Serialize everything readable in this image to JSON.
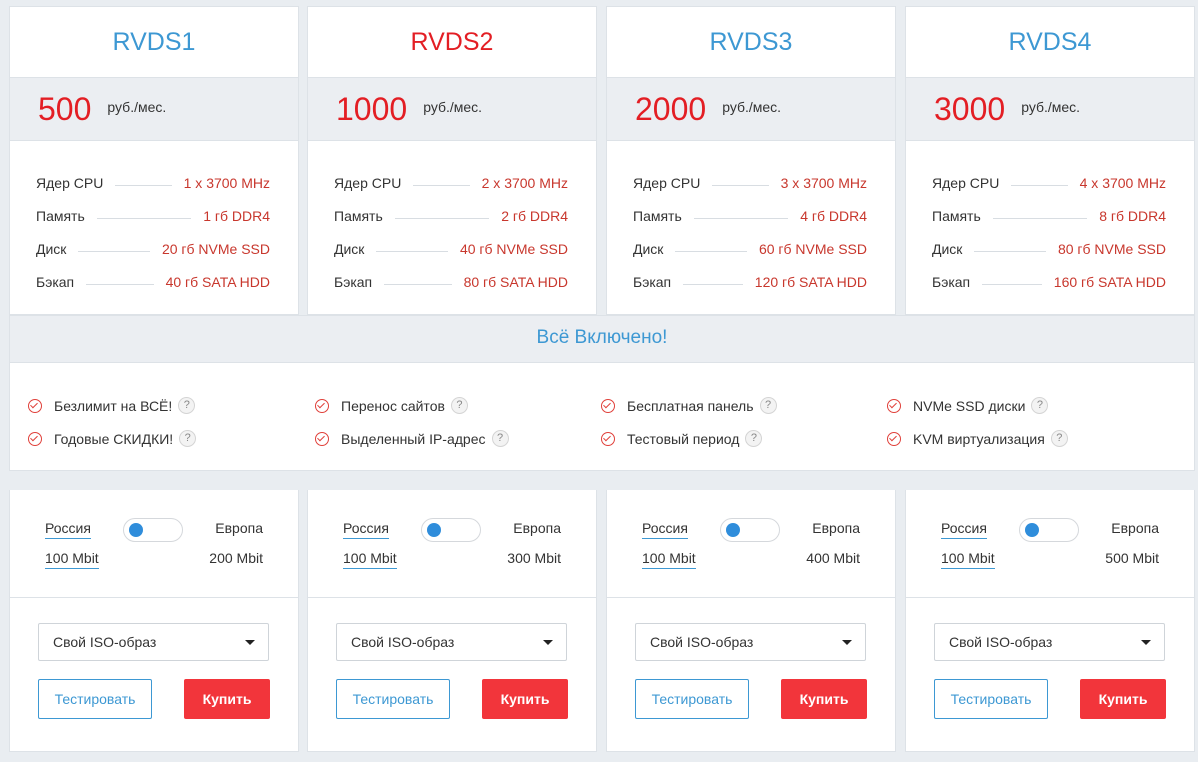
{
  "colors": {
    "accent_blue": "#3d98d3",
    "accent_red": "#e31e24",
    "buy_button": "#f2353b",
    "background": "#e9edf1"
  },
  "plans": [
    {
      "name": "RVDS1",
      "highlight": false,
      "price": "500",
      "unit": "руб./мес.",
      "specs": [
        {
          "label": "Ядер CPU",
          "value": "1 x 3700 MHz"
        },
        {
          "label": "Память",
          "value": "1 гб DDR4"
        },
        {
          "label": "Диск",
          "value": "20 гб NVMe SSD"
        },
        {
          "label": "Бэкап",
          "value": "40 гб SATA HDD"
        }
      ],
      "region_left": "Россия",
      "region_right": "Европа",
      "speed_left": "100 Mbit",
      "speed_right": "200 Mbit",
      "iso_select": "Свой ISO-образ",
      "test_label": "Тестировать",
      "buy_label": "Купить"
    },
    {
      "name": "RVDS2",
      "highlight": true,
      "price": "1000",
      "unit": "руб./мес.",
      "specs": [
        {
          "label": "Ядер CPU",
          "value": "2 x 3700 MHz"
        },
        {
          "label": "Память",
          "value": "2 гб DDR4"
        },
        {
          "label": "Диск",
          "value": "40 гб NVMe SSD"
        },
        {
          "label": "Бэкап",
          "value": "80 гб SATA HDD"
        }
      ],
      "region_left": "Россия",
      "region_right": "Европа",
      "speed_left": "100 Mbit",
      "speed_right": "300 Mbit",
      "iso_select": "Свой ISO-образ",
      "test_label": "Тестировать",
      "buy_label": "Купить"
    },
    {
      "name": "RVDS3",
      "highlight": false,
      "price": "2000",
      "unit": "руб./мес.",
      "specs": [
        {
          "label": "Ядер CPU",
          "value": "3 x 3700 MHz"
        },
        {
          "label": "Память",
          "value": "4 гб DDR4"
        },
        {
          "label": "Диск",
          "value": "60 гб NVMe SSD"
        },
        {
          "label": "Бэкап",
          "value": "120 гб SATA HDD"
        }
      ],
      "region_left": "Россия",
      "region_right": "Европа",
      "speed_left": "100 Mbit",
      "speed_right": "400 Mbit",
      "iso_select": "Свой ISO-образ",
      "test_label": "Тестировать",
      "buy_label": "Купить"
    },
    {
      "name": "RVDS4",
      "highlight": false,
      "price": "3000",
      "unit": "руб./мес.",
      "specs": [
        {
          "label": "Ядер CPU",
          "value": "4 x 3700 MHz"
        },
        {
          "label": "Память",
          "value": "8 гб DDR4"
        },
        {
          "label": "Диск",
          "value": "80 гб NVMe SSD"
        },
        {
          "label": "Бэкап",
          "value": "160 гб SATA HDD"
        }
      ],
      "region_left": "Россия",
      "region_right": "Европа",
      "speed_left": "100 Mbit",
      "speed_right": "500 Mbit",
      "iso_select": "Свой ISO-образ",
      "test_label": "Тестировать",
      "buy_label": "Купить"
    }
  ],
  "included": {
    "title": "Всё Включено!",
    "help_glyph": "?",
    "columns": [
      [
        "Безлимит на ВСЁ!",
        "Годовые СКИДКИ!"
      ],
      [
        "Перенос сайтов",
        "Выделенный IP-адрес"
      ],
      [
        "Бесплатная панель",
        "Тестовый период"
      ],
      [
        "NVMe SSD диски",
        "KVM виртуализация"
      ]
    ]
  }
}
